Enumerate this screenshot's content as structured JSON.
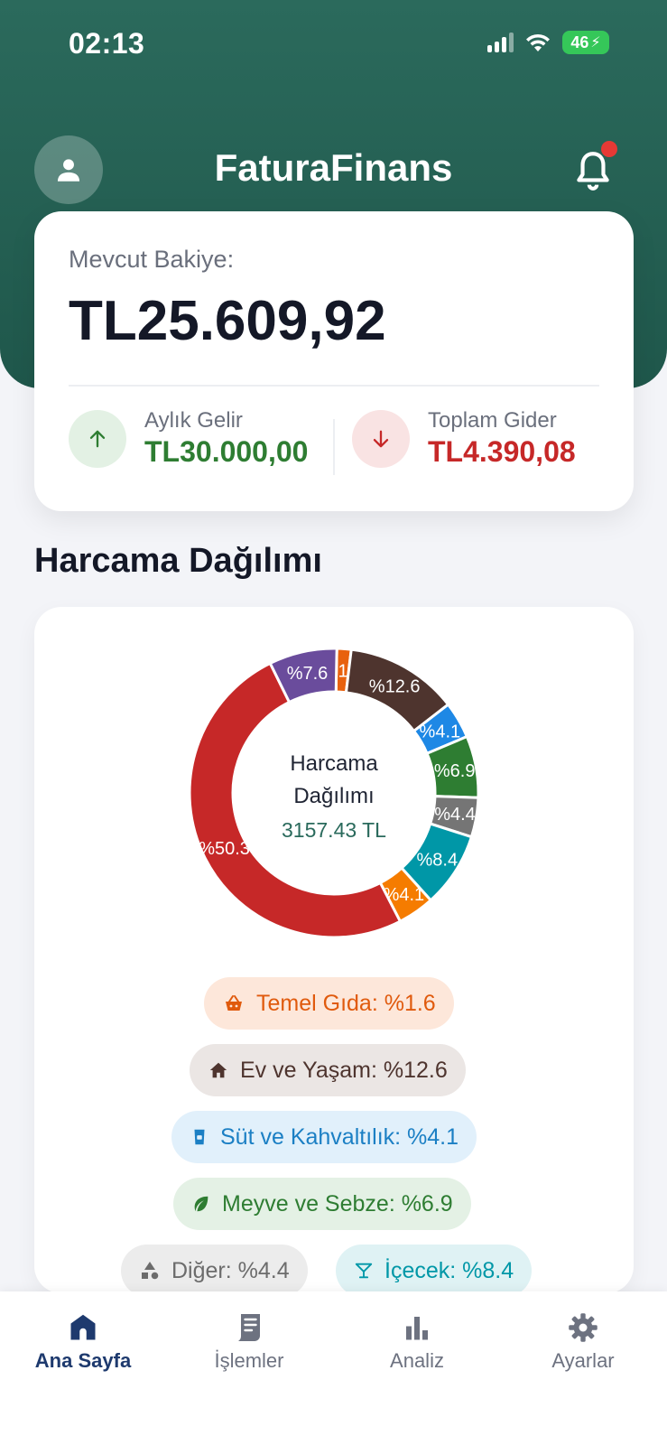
{
  "status_bar": {
    "time": "02:13",
    "battery": "46"
  },
  "header": {
    "title": "FaturaFinans"
  },
  "balance": {
    "label": "Mevcut Bakiye:",
    "value": "TL25.609,92",
    "income_label": "Aylık Gelir",
    "income_value": "TL30.000,00",
    "expense_label": "Toplam Gider",
    "expense_value": "TL4.390,08"
  },
  "section": {
    "title": "Harcama Dağılımı"
  },
  "donut": {
    "center_title_1": "Harcama",
    "center_title_2": "Dağılımı",
    "center_value": "3157.43 TL"
  },
  "chart_data": {
    "type": "pie",
    "title": "Harcama Dağılımı",
    "total": "3157.43 TL",
    "slices": [
      {
        "label": "%1.6",
        "value": 1.6,
        "color": "#e8610e"
      },
      {
        "label": "%12.6",
        "value": 12.6,
        "color": "#4e342e"
      },
      {
        "label": "%4.1",
        "value": 4.1,
        "color": "#1e88e5"
      },
      {
        "label": "%6.9",
        "value": 6.9,
        "color": "#2e7d32"
      },
      {
        "label": "%4.4",
        "value": 4.4,
        "color": "#757575"
      },
      {
        "label": "%8.4",
        "value": 8.4,
        "color": "#0097a7"
      },
      {
        "label": "%4.1",
        "value": 4.1,
        "color": "#f57c00"
      },
      {
        "label": "%50.3",
        "value": 50.3,
        "color": "#c62828"
      },
      {
        "label": "%7.6",
        "value": 7.6,
        "color": "#6a4c9c"
      }
    ]
  },
  "legend": [
    {
      "text": "Temel Gıda: %1.6",
      "icon": "basket-icon"
    },
    {
      "text": "Ev ve Yaşam: %12.6",
      "icon": "home-icon"
    },
    {
      "text": "Süt ve Kahvaltılık: %4.1",
      "icon": "milk-icon"
    },
    {
      "text": "Meyve ve Sebze: %6.9",
      "icon": "leaf-icon"
    },
    {
      "text": "Diğer: %4.4",
      "icon": "shapes-icon"
    },
    {
      "text": "İçecek: %8.4",
      "icon": "cocktail-icon"
    }
  ],
  "nav": [
    {
      "label": "Ana Sayfa",
      "icon": "home-icon"
    },
    {
      "label": "İşlemler",
      "icon": "receipt-icon"
    },
    {
      "label": "Analiz",
      "icon": "bar-chart-icon"
    },
    {
      "label": "Ayarlar",
      "icon": "gear-icon"
    }
  ]
}
